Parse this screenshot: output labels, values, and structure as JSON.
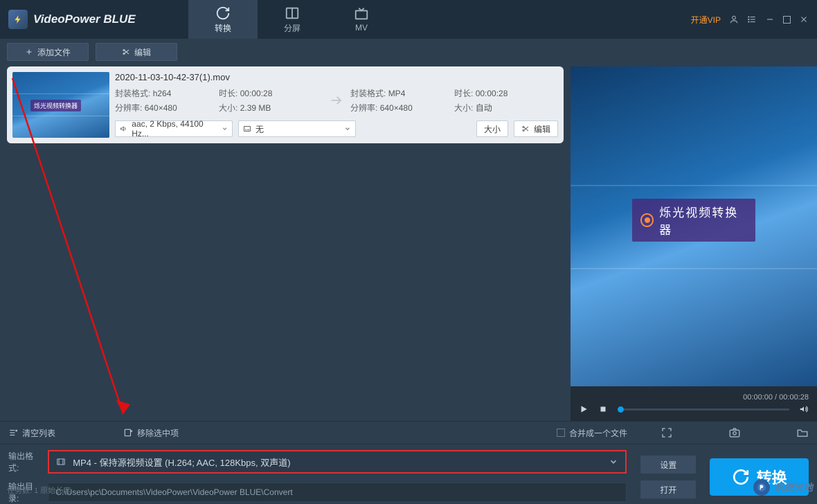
{
  "app": {
    "title": "VideoPower BLUE"
  },
  "titlebar": {
    "vip": "开通VIP"
  },
  "tabs": {
    "convert": "转换",
    "split": "分屏",
    "mv": "MV"
  },
  "toolbar": {
    "add_file": "添加文件",
    "edit": "编辑"
  },
  "file": {
    "name": "2020-11-03-10-42-37(1).mov",
    "thumb_badge": "烁光视频转换器",
    "src": {
      "container_label": "封装格式:",
      "container": "h264",
      "duration_label": "时长:",
      "duration": "00:00:28",
      "res_label": "分辨率:",
      "res": "640×480",
      "size_label": "大小:",
      "size": "2.39 MB"
    },
    "dst": {
      "container_label": "封装格式:",
      "container": "MP4",
      "duration_label": "时长:",
      "duration": "00:00:28",
      "res_label": "分辨率:",
      "res": "640×480",
      "size_label": "大小:",
      "size": "自动"
    },
    "audio_dd": "aac, 2 Kbps, 44100 Hz...",
    "subtitle_dd": "无",
    "size_btn": "大小",
    "edit_btn": "编辑"
  },
  "preview": {
    "badge": "烁光视频转换器",
    "time_current": "00:00:00",
    "time_total": "00:00:28"
  },
  "midbar": {
    "clear": "清空列表",
    "remove_selected": "移除选中项",
    "merge": "合并成一个文件"
  },
  "output": {
    "format_label": "输出格式:",
    "format_value": "MP4 - 保持源视频设置 (H.264; AAC, 128Kbps, 双声道)",
    "dir_label": "输出目录:",
    "dir_value": "C:\\Users\\pc\\Documents\\VideoPower\\VideoPower BLUE\\Convert",
    "settings_btn": "设置",
    "open_btn": "打开",
    "convert_btn": "转换"
  },
  "status": {
    "tasks": "任务数: 1    原始长度"
  },
  "watermark": {
    "text": "系统天地"
  }
}
